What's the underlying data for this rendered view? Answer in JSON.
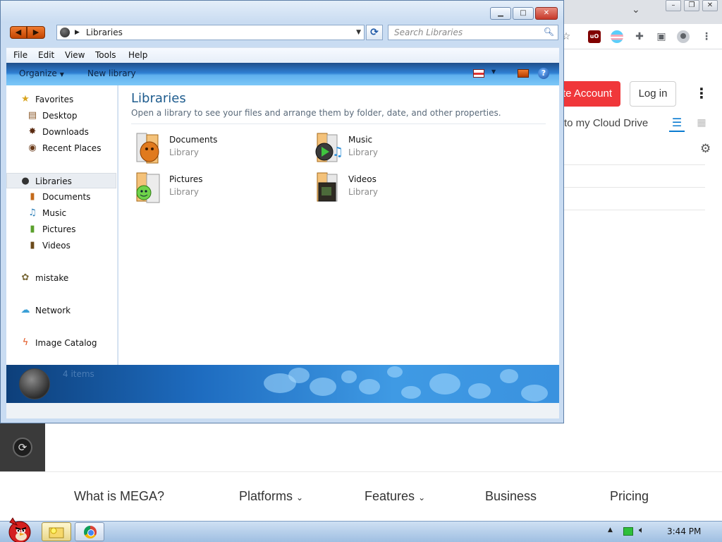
{
  "browser": {
    "create_account_label": "te Account",
    "login_label": "Log in",
    "cloud_drive_label": "to my Cloud Drive",
    "ublock_label": "uO",
    "nav": {
      "what_is": "What is MEGA?",
      "platforms": "Platforms",
      "features": "Features",
      "business": "Business",
      "pricing": "Pricing"
    }
  },
  "explorer": {
    "address": "Libraries",
    "search_placeholder": "Search Libraries",
    "menu": [
      "File",
      "Edit",
      "View",
      "Tools",
      "Help"
    ],
    "commands": {
      "organize": "Organize",
      "new_library": "New library"
    },
    "sidebar": {
      "favorites": "Favorites",
      "desktop": "Desktop",
      "downloads": "Downloads",
      "recent_places": "Recent Places",
      "libraries": "Libraries",
      "documents": "Documents",
      "music": "Music",
      "pictures": "Pictures",
      "videos": "Videos",
      "homegroup": "mistake",
      "network": "Network",
      "image_catalog": "Image Catalog"
    },
    "content": {
      "title": "Libraries",
      "subtitle": "Open a library to see your files and arrange them by folder, date, and other properties.",
      "items": [
        {
          "name": "Documents",
          "type": "Library",
          "icon": "documents-library-icon"
        },
        {
          "name": "Music",
          "type": "Library",
          "icon": "music-library-icon"
        },
        {
          "name": "Pictures",
          "type": "Library",
          "icon": "pictures-library-icon"
        },
        {
          "name": "Videos",
          "type": "Library",
          "icon": "videos-library-icon"
        }
      ]
    },
    "status": "4 items"
  },
  "taskbar": {
    "clock": "3:44 PM"
  },
  "colors": {
    "mega_red": "#f0373a",
    "accent_blue": "#1e5c8e",
    "command_bar": "#2f7fd2"
  }
}
